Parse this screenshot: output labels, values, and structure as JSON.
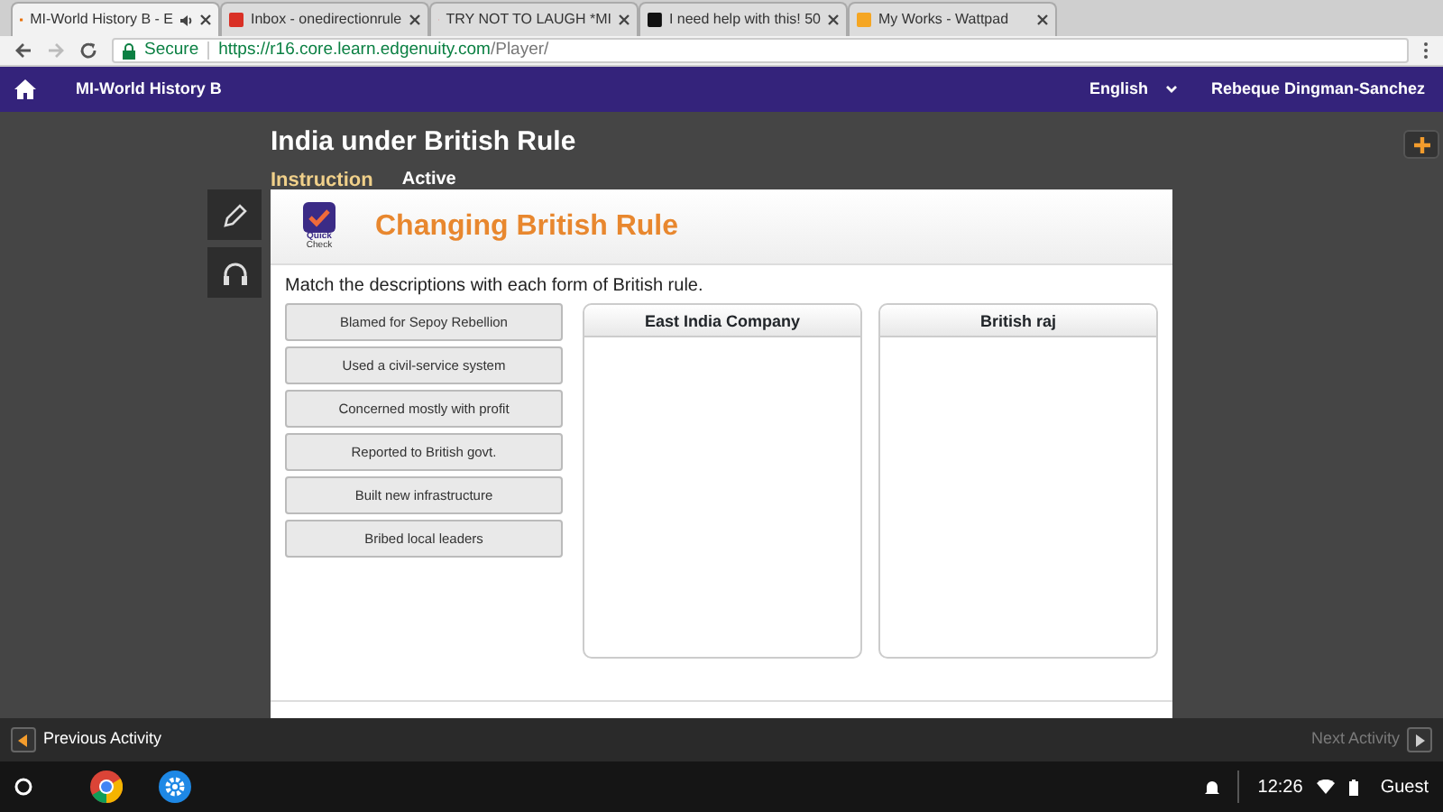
{
  "browser": {
    "tabs": [
      {
        "title": "MI-World History B - E",
        "selected": true,
        "audio": true
      },
      {
        "title": "Inbox - onedirectionrule",
        "selected": false,
        "audio": false
      },
      {
        "title": "TRY NOT TO LAUGH *MI",
        "selected": false,
        "audio": false
      },
      {
        "title": "I need help with this! 50",
        "selected": false,
        "audio": false
      },
      {
        "title": "My Works - Wattpad",
        "selected": false,
        "audio": false
      }
    ],
    "secure_label": "Secure",
    "url_host": "https://r16.core.learn.edgenuity.com",
    "url_path": "/Player/"
  },
  "navbar": {
    "course": "MI-World History B",
    "language": "English",
    "user": "Rebeque Dingman-Sanchez"
  },
  "lesson": {
    "title": "India under British Rule",
    "tabs": [
      {
        "label": "Instruction",
        "selected": true
      },
      {
        "label": "Active",
        "selected": false
      }
    ]
  },
  "activity": {
    "badge_line1": "Quick",
    "badge_line2": "Check",
    "title": "Changing British Rule",
    "prompt": "Match the descriptions with each form of British rule.",
    "items": [
      "Blamed for Sepoy Rebellion",
      "Used a civil-service system",
      "Concerned mostly with profit",
      "Reported to British govt.",
      "Built new infrastructure",
      "Bribed local leaders"
    ],
    "targets": [
      "East India Company",
      "British raj"
    ]
  },
  "footer": {
    "previous": {
      "label": "Previous Activity",
      "disabled": false
    },
    "next": {
      "label": "Next Activity",
      "disabled": true
    }
  },
  "taskbar": {
    "time": "12:26",
    "user": "Guest"
  }
}
